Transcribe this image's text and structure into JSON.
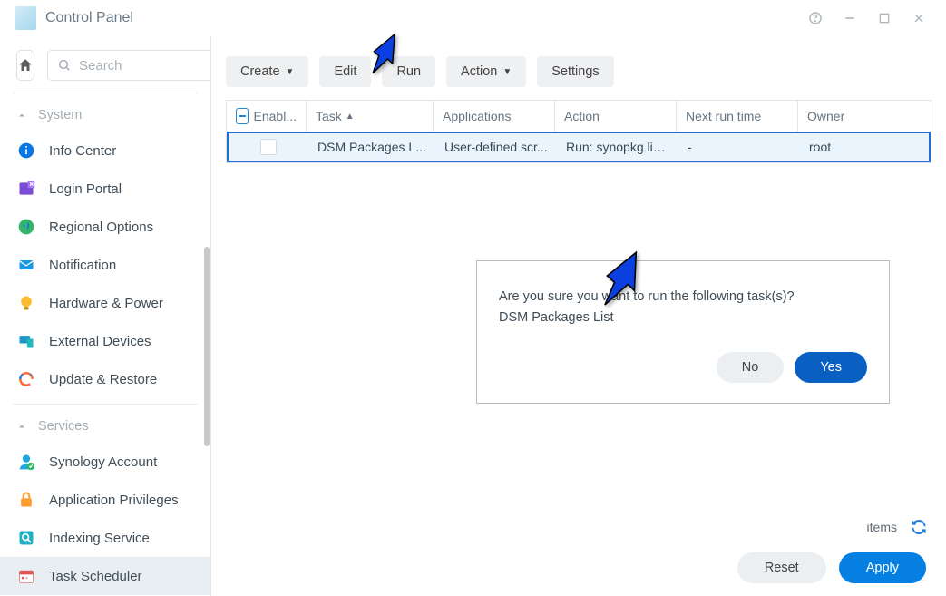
{
  "window": {
    "title": "Control Panel"
  },
  "search": {
    "placeholder": "Search"
  },
  "sidebar": {
    "group_system": "System",
    "group_services": "Services",
    "items_system": [
      {
        "label": "Info Center"
      },
      {
        "label": "Login Portal"
      },
      {
        "label": "Regional Options"
      },
      {
        "label": "Notification"
      },
      {
        "label": "Hardware & Power"
      },
      {
        "label": "External Devices"
      },
      {
        "label": "Update & Restore"
      }
    ],
    "items_services": [
      {
        "label": "Synology Account"
      },
      {
        "label": "Application Privileges"
      },
      {
        "label": "Indexing Service"
      },
      {
        "label": "Task Scheduler"
      }
    ]
  },
  "toolbar": {
    "create": "Create",
    "edit": "Edit",
    "run": "Run",
    "action": "Action",
    "settings": "Settings"
  },
  "table": {
    "headers": {
      "enabled": "Enabl...",
      "task": "Task",
      "applications": "Applications",
      "action": "Action",
      "next_run_time": "Next run time",
      "owner": "Owner"
    },
    "rows": [
      {
        "task": "DSM Packages L...",
        "applications": "User-defined scr...",
        "action": "Run: synopkg lis...",
        "next": "-",
        "owner": "root"
      }
    ]
  },
  "dialog": {
    "line1": "Are you sure you want to run the following task(s)?",
    "line2": "DSM Packages List",
    "no": "No",
    "yes": "Yes"
  },
  "footer": {
    "items_label": "items",
    "reset": "Reset",
    "apply": "Apply"
  }
}
